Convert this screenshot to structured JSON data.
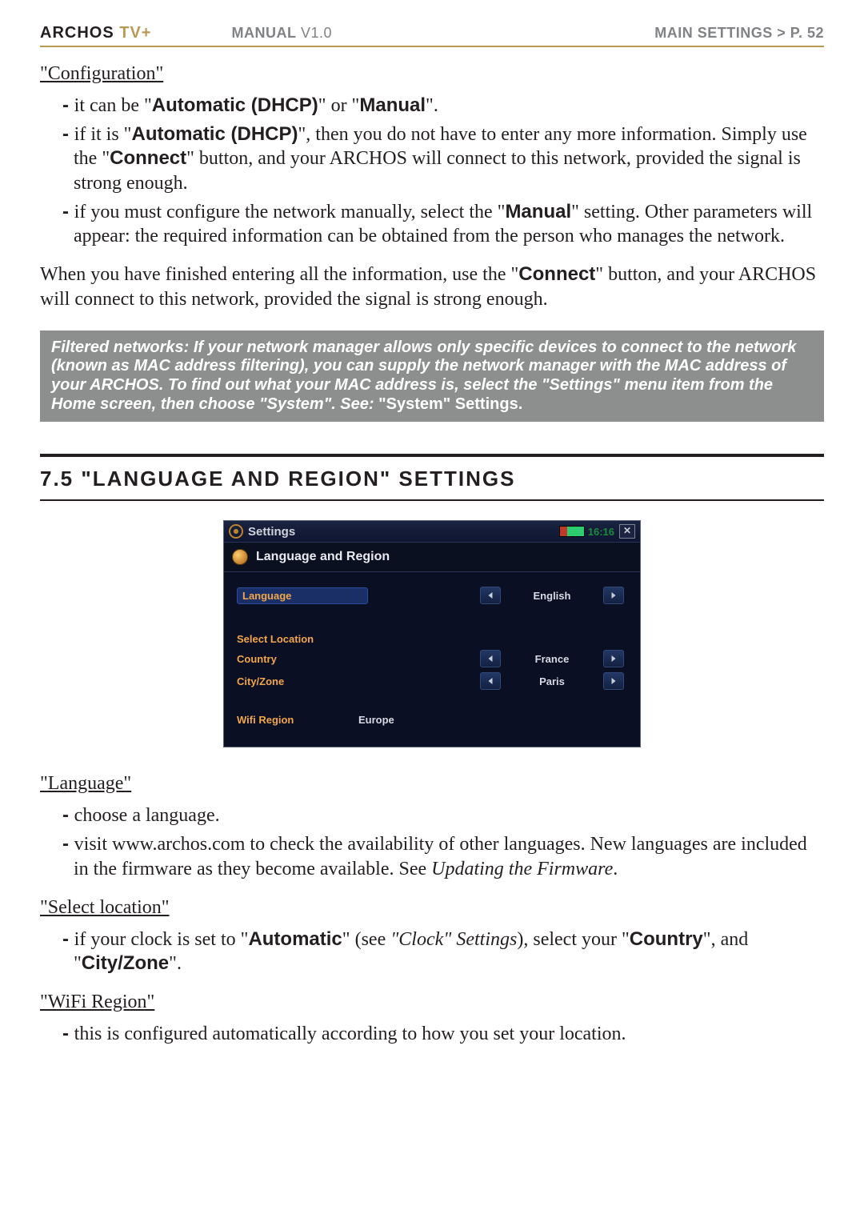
{
  "header": {
    "brand_black": "ARCHOS",
    "brand_accent": " TV+",
    "manual": "MANUAL",
    "version": " V1.0",
    "breadcrumb": "MAIN SETTINGS   >   P. 52"
  },
  "config": {
    "title": "\"Configuration\"",
    "bullets": [
      {
        "pre": "it can be \"",
        "b1": "Automatic (DHCP)",
        "mid1": "\" or \"",
        "b2": "Manual",
        "post": "\"."
      },
      {
        "pre": "if it is \"",
        "b1": "Automatic (DHCP)",
        "mid1": "\", then you do not have to enter any more information. Simply use the \"",
        "b2": "Connect",
        "post": "\" button, and your ARCHOS will connect to this network, provided the signal is strong enough."
      },
      {
        "pre": "if you must configure the network manually, select the \"",
        "b1": "Manual",
        "mid1": "\" setting. Other parameters will appear: the required information can be obtained from the person who manages the network.",
        "b2": "",
        "post": ""
      }
    ],
    "paragraph_pre": "When you have finished entering all the information, use the \"",
    "paragraph_bold": "Connect",
    "paragraph_post": "\" button, and your ARCHOS will connect to this network, provided the signal is strong enough."
  },
  "callout": {
    "body": "Filtered networks: If your network manager allows only specific devices to connect to the network (known as MAC address filtering), you can supply the network manager with the MAC address of your ARCHOS. To find out what your MAC address is, select the \"Settings\" menu item from the Home screen, then choose \"System\". See: ",
    "see": "\"System\" Settings",
    "trail": "."
  },
  "section75": {
    "heading": "7.5 \"LANGUAGE AND REGION\" SETTINGS"
  },
  "shot": {
    "title": "Settings",
    "clock": "16:16",
    "close": "✕",
    "subtitle": "Language and Region",
    "rows": {
      "language_label": "Language",
      "language_value": "English",
      "select_location_label": "Select Location",
      "country_label": "Country",
      "country_value": "France",
      "cityzone_label": "City/Zone",
      "cityzone_value": "Paris",
      "wifi_region_label": "Wifi Region",
      "wifi_region_value": "Europe"
    }
  },
  "language": {
    "title": "\"Language\"",
    "bullets": [
      "choose a language.",
      "visit www.archos.com to check the availability of other languages. New languages are included in the firmware as they become available. See "
    ],
    "see_ref": "Updating the Firmware",
    "trail": "."
  },
  "select_location": {
    "title": "\"Select location\"",
    "bullet_pre": "if your clock is set to \"",
    "bullet_b1": "Automatic",
    "bullet_mid1": "\" (see ",
    "bullet_i1": "\"Clock\" Settings",
    "bullet_mid2": "), select your \"",
    "bullet_b2": "Country",
    "bullet_mid3": "\", and \"",
    "bullet_b3": "City/Zone",
    "bullet_post": "\"."
  },
  "wifi_region": {
    "title": "\"WiFi Region\"",
    "bullet": "this is configured automatically according to how you set your location."
  }
}
